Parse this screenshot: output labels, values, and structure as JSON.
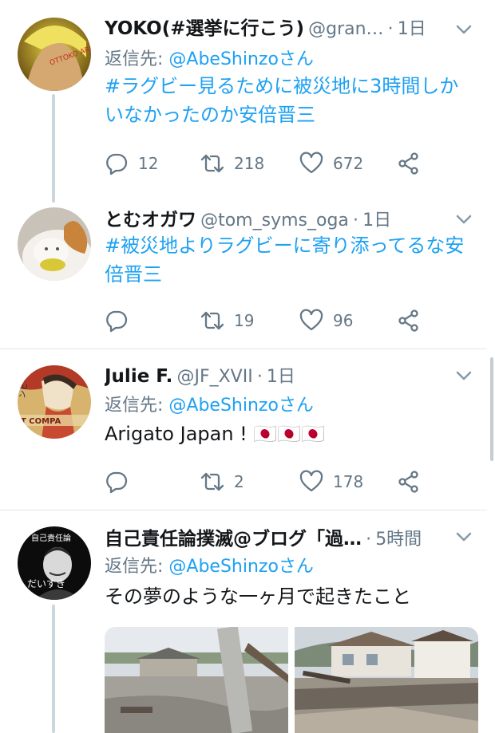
{
  "tweets": [
    {
      "name": "YOKO(#選挙に行こう)",
      "handle": "@gran…",
      "time": "1日",
      "reply_prefix": "返信先: ",
      "reply_to": "@AbeShinzoさん",
      "text": "#ラグビー見るために被災地に3時間しかいなかったのか安倍晋三",
      "replies": "12",
      "retweets": "218",
      "likes": "672",
      "avatar_text": "OTTOKO ARAM"
    },
    {
      "name": "とむオガワ",
      "handle": "@tom_syms_oga",
      "time": "1日",
      "text": "#被災地よりラグビーに寄り添ってるな安倍晋三",
      "replies": "",
      "retweets": "19",
      "likes": "96"
    },
    {
      "name": "Julie F.",
      "handle": "@JF_XVII",
      "time": "1日",
      "reply_prefix": "返信先: ",
      "reply_to": "@AbeShinzoさん",
      "text": "Arigato Japan ! 🇯🇵🇯🇵🇯🇵",
      "replies": "",
      "retweets": "2",
      "likes": "178",
      "avatar_text_top": "ンビール",
      "avatar_text_bottom": "T COMPA"
    },
    {
      "name": "自己責任論撲滅@ブログ「過…",
      "time": "5時間",
      "reply_prefix": "返信先: ",
      "reply_to": "@AbeShinzoさん",
      "text": "その夢のような一ヶ月で起きたこと",
      "avatar_text_top": "自己責任論",
      "avatar_text_bottom": "だいすき"
    }
  ],
  "separator": "·",
  "icons": {
    "reply": "reply-bubble-icon",
    "retweet": "retweet-icon",
    "like": "heart-icon",
    "share": "share-icon",
    "caret": "chevron-down-icon"
  },
  "colors": {
    "link": "#1da1f2",
    "meta": "#657786",
    "thread": "#ccd6dd",
    "divider": "#e1e8ed"
  }
}
